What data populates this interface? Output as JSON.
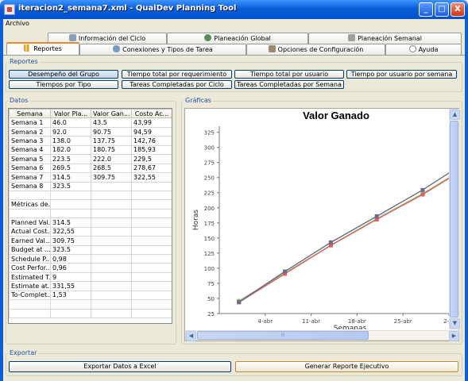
{
  "window": {
    "title": "iteracion2_semana7.xml - QualDev Planning Tool",
    "minimize": "_",
    "maximize": "□",
    "close": "X"
  },
  "menu": {
    "archivo": "Archivo"
  },
  "tabs_row1": [
    {
      "label": "Información del Ciclo",
      "icon": "grid-icon"
    },
    {
      "label": "Planeación Global",
      "icon": "globe-icon"
    },
    {
      "label": "Planeación Semanal",
      "icon": "calendar-icon"
    }
  ],
  "tabs_row2": [
    {
      "label": "Reportes",
      "icon": "bar-chart-icon"
    },
    {
      "label": "Conexiones y  Tipos de Tarea",
      "icon": "link-icon"
    },
    {
      "label": "Opciones de Configuración",
      "icon": "settings-icon"
    },
    {
      "label": "Ayuda",
      "icon": "help-icon"
    }
  ],
  "reportes": {
    "label": "Reportes",
    "buttons": [
      "Desempeño del Grupo",
      "Tiempo total por requerimiento",
      "Tiempo total por usuario",
      "Tiempo por usuario por semana",
      "Tiempos por Tipo",
      "Tareas Completadas por Ciclo",
      "Tareas Completadas por Semana"
    ]
  },
  "datos": {
    "label": "Datos",
    "columns": [
      "Semana",
      "Valor Pla...",
      "Valor Gan...",
      "Costo Ac..."
    ],
    "rows": [
      [
        "Semana 1",
        "46.0",
        "43.5",
        "43,99"
      ],
      [
        "Semana 2",
        "92.0",
        "90.75",
        "94,59"
      ],
      [
        "Semana 3",
        "138.0",
        "137.75",
        "142,76"
      ],
      [
        "Semana 4",
        "182.0",
        "180.75",
        "185,93"
      ],
      [
        "Semana 5",
        "223.5",
        "222.0",
        "229,5"
      ],
      [
        "Semana 6",
        "269.5",
        "268.5",
        "278,67"
      ],
      [
        "Semana 7",
        "314.5",
        "309.75",
        "322,55"
      ],
      [
        "Semana 8",
        "323.5",
        "",
        ""
      ],
      [
        "",
        "",
        "",
        ""
      ],
      [
        "Métricas de...",
        "",
        "",
        ""
      ],
      [
        "",
        "",
        "",
        ""
      ],
      [
        "Planned Val...",
        "314.5",
        "",
        ""
      ],
      [
        "Actual Cost...",
        "322,55",
        "",
        ""
      ],
      [
        "Earned Val...",
        "309.75",
        "",
        ""
      ],
      [
        "Budget at ...",
        "323.5",
        "",
        ""
      ],
      [
        "Schedule P...",
        "0,98",
        "",
        ""
      ],
      [
        "Cost Perfor...",
        "0,96",
        "",
        ""
      ],
      [
        "Estimated T...",
        "9",
        "",
        ""
      ],
      [
        "Estimate at...",
        "331,55",
        "",
        ""
      ],
      [
        "To-Complet...",
        "1,53",
        "",
        ""
      ],
      [
        "",
        "",
        "",
        ""
      ],
      [
        "",
        "",
        "",
        ""
      ]
    ]
  },
  "graficas": {
    "label": "Gráficas"
  },
  "chart_data": {
    "type": "line",
    "title": "Valor Ganado",
    "xlabel": "Semanas",
    "ylabel": "Horas",
    "x_ticks": [
      "4-abr",
      "11-abr",
      "18-abr",
      "25-abr",
      "2-m"
    ],
    "y_ticks": [
      25,
      50,
      75,
      100,
      125,
      150,
      175,
      200,
      225,
      250,
      275,
      300,
      325
    ],
    "ylim": [
      25,
      335
    ],
    "x_dates": [
      "2008-03-31",
      "2008-04-07",
      "2008-04-14",
      "2008-04-21",
      "2008-04-28"
    ],
    "xlim_dates": [
      "2008-03-28",
      "2008-05-02"
    ],
    "series": [
      {
        "color": "#8fd07a",
        "values": [
          46.0,
          92.0,
          138.0,
          182.0,
          223.5,
          269.5
        ]
      },
      {
        "color": "#d9605f",
        "values": [
          43.5,
          90.75,
          137.75,
          180.75,
          222.0,
          268.5
        ]
      },
      {
        "color": "#6a6a8a",
        "values": [
          43.99,
          94.59,
          142.76,
          185.93,
          229.5,
          278.67
        ]
      }
    ],
    "grid": false
  },
  "scrollbar": {
    "thumb_grip": "|||"
  },
  "exportar": {
    "label": "Exportar",
    "excel": "Exportar Datos a Excel",
    "ejecutivo": "Generar Reporte Ejecutivo"
  }
}
